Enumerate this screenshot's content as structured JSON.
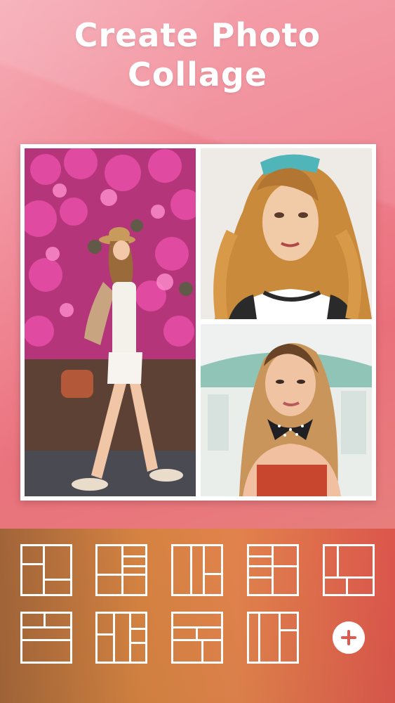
{
  "header": {
    "title_line1": "Create Photo",
    "title_line2": "Collage"
  },
  "collage": {
    "photos": [
      {
        "name": "woman walking by pink flowers"
      },
      {
        "name": "woman with bandana portrait"
      },
      {
        "name": "woman with polka-dot scarf portrait"
      }
    ]
  },
  "layouts": {
    "count": 9,
    "items": [
      "layout-1",
      "layout-2",
      "layout-3",
      "layout-4",
      "layout-5",
      "layout-6",
      "layout-7",
      "layout-8",
      "layout-9"
    ]
  },
  "add_button": {
    "icon": "plus-icon"
  },
  "colors": {
    "accent": "#e05a4e",
    "panel_left": "#a4663a",
    "panel_right": "#e0574e",
    "background": "#ef7e8c"
  }
}
